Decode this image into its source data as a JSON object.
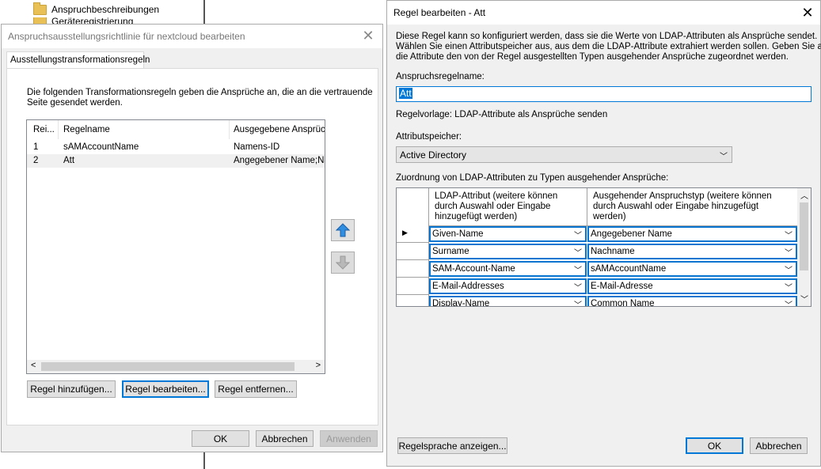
{
  "explorer": {
    "items": [
      "Anspruchbeschreibungen",
      "Geräteregistrierung"
    ]
  },
  "left_dialog": {
    "title": "Anspruchsausstellungsrichtlinie für nextcloud bearbeiten",
    "tab": "Ausstellungstransformationsregeln",
    "description": [
      "Die folgenden Transformationsregeln geben die Ansprüche an, die an die vertrauende",
      "Seite gesendet werden."
    ],
    "columns": [
      "Rei...",
      "Regelname",
      "Ausgegebene Ansprüch"
    ],
    "rows": [
      {
        "order": "1",
        "name": "sAMAccountName",
        "claims": "Namens-ID"
      },
      {
        "order": "2",
        "name": "Att",
        "claims": "Angegebener Name;Nac"
      }
    ],
    "buttons": {
      "add": "Regel hinzufügen...",
      "edit": "Regel bearbeiten...",
      "remove": "Regel entfernen..."
    },
    "footer": {
      "ok": "OK",
      "cancel": "Abbrechen",
      "apply": "Anwenden"
    }
  },
  "right_dialog": {
    "title": "Regel bearbeiten - Att",
    "description": [
      "Diese Regel kann so konfiguriert werden, dass sie die Werte von LDAP-Attributen als Ansprüche sendet.",
      "Wählen Sie einen Attributspeicher aus, aus dem die LDAP-Attribute extrahiert werden sollen. Geben Sie an, wie",
      "die Attribute den von der Regel ausgestellten Typen ausgehender Ansprüche zugeordnet werden."
    ],
    "rule_name_label": "Anspruchsregelname:",
    "rule_name_value": "Att",
    "template_text": "Regelvorlage: LDAP-Attribute als Ansprüche senden",
    "store_label": "Attributspeicher:",
    "store_value": "Active Directory",
    "mapping_label": "Zuordnung von LDAP-Attributen zu Typen ausgehender Ansprüche:",
    "col_ldap": [
      "LDAP-Attribut (weitere können",
      "durch Auswahl oder Eingabe",
      "hinzugefügt werden)"
    ],
    "col_claim": [
      "Ausgehender Anspruchstyp (weitere können",
      "durch Auswahl oder Eingabe hinzugefügt",
      "werden)"
    ],
    "mappings": [
      {
        "ldap": "Given-Name",
        "claim": "Angegebener Name"
      },
      {
        "ldap": "Surname",
        "claim": "Nachname"
      },
      {
        "ldap": "SAM-Account-Name",
        "claim": "sAMAccountName"
      },
      {
        "ldap": "E-Mail-Addresses",
        "claim": "E-Mail-Adresse"
      },
      {
        "ldap": "Display-Name",
        "claim": "Common Name"
      }
    ],
    "buttons": {
      "view_rule": "Regelsprache anzeigen...",
      "ok": "OK",
      "cancel": "Abbrechen"
    }
  }
}
